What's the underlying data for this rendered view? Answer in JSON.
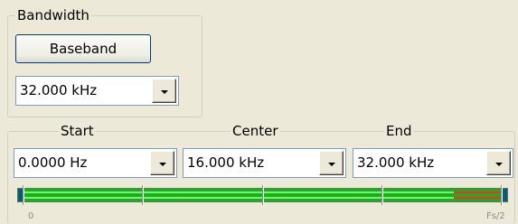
{
  "bandwidth": {
    "legend": "Bandwidth",
    "baseband_button": "Baseband",
    "selected": "32.000 kHz"
  },
  "frequency": {
    "start": {
      "legend": "Start",
      "selected": "0.0000 Hz"
    },
    "center": {
      "legend": "Center",
      "selected": "16.000 kHz"
    },
    "end": {
      "legend": "End",
      "selected": "32.000 kHz"
    }
  },
  "range_bar": {
    "axis_start_label": "0",
    "axis_end_label": "Fs/2",
    "markers": [
      0.0,
      0.25,
      0.5,
      0.75,
      1.0
    ],
    "excess_fraction": 0.1,
    "colors": {
      "band_fill": "#22aa22",
      "band_lines": "#66ff66",
      "excess_lines": "#ff2a2a",
      "end_caps": "#0a5a7a"
    }
  }
}
